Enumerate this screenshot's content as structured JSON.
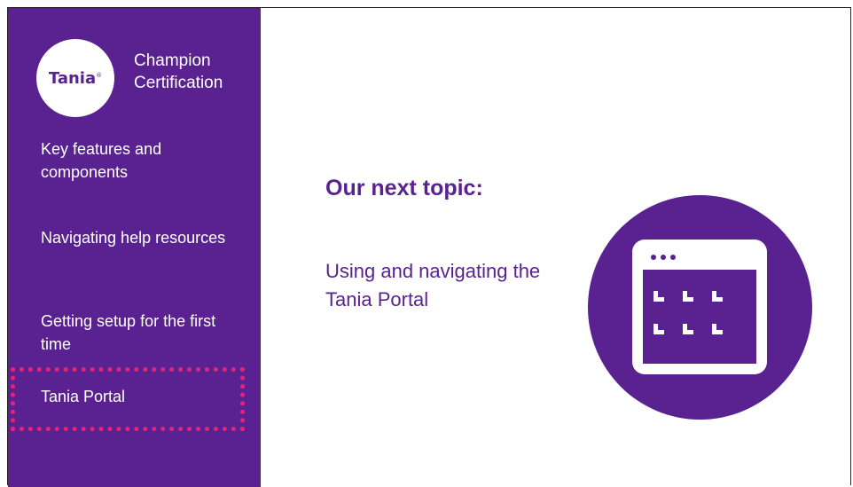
{
  "logo": {
    "name": "Tania",
    "mark": "®"
  },
  "program": {
    "title": "Champion Certification"
  },
  "sidebar": {
    "items": [
      {
        "label": "Key features and components"
      },
      {
        "label": "Navigating help resources"
      },
      {
        "label": "Getting setup for the first time"
      },
      {
        "label": "Tania Portal"
      }
    ],
    "highlight_color": "#e8227a"
  },
  "main": {
    "heading": "Our next topic:",
    "description": "Using and navigating the Tania Portal",
    "icon": "portal-window-icon"
  },
  "colors": {
    "brand": "#5a2291",
    "accent": "#e8227a",
    "background": "#ffffff"
  }
}
